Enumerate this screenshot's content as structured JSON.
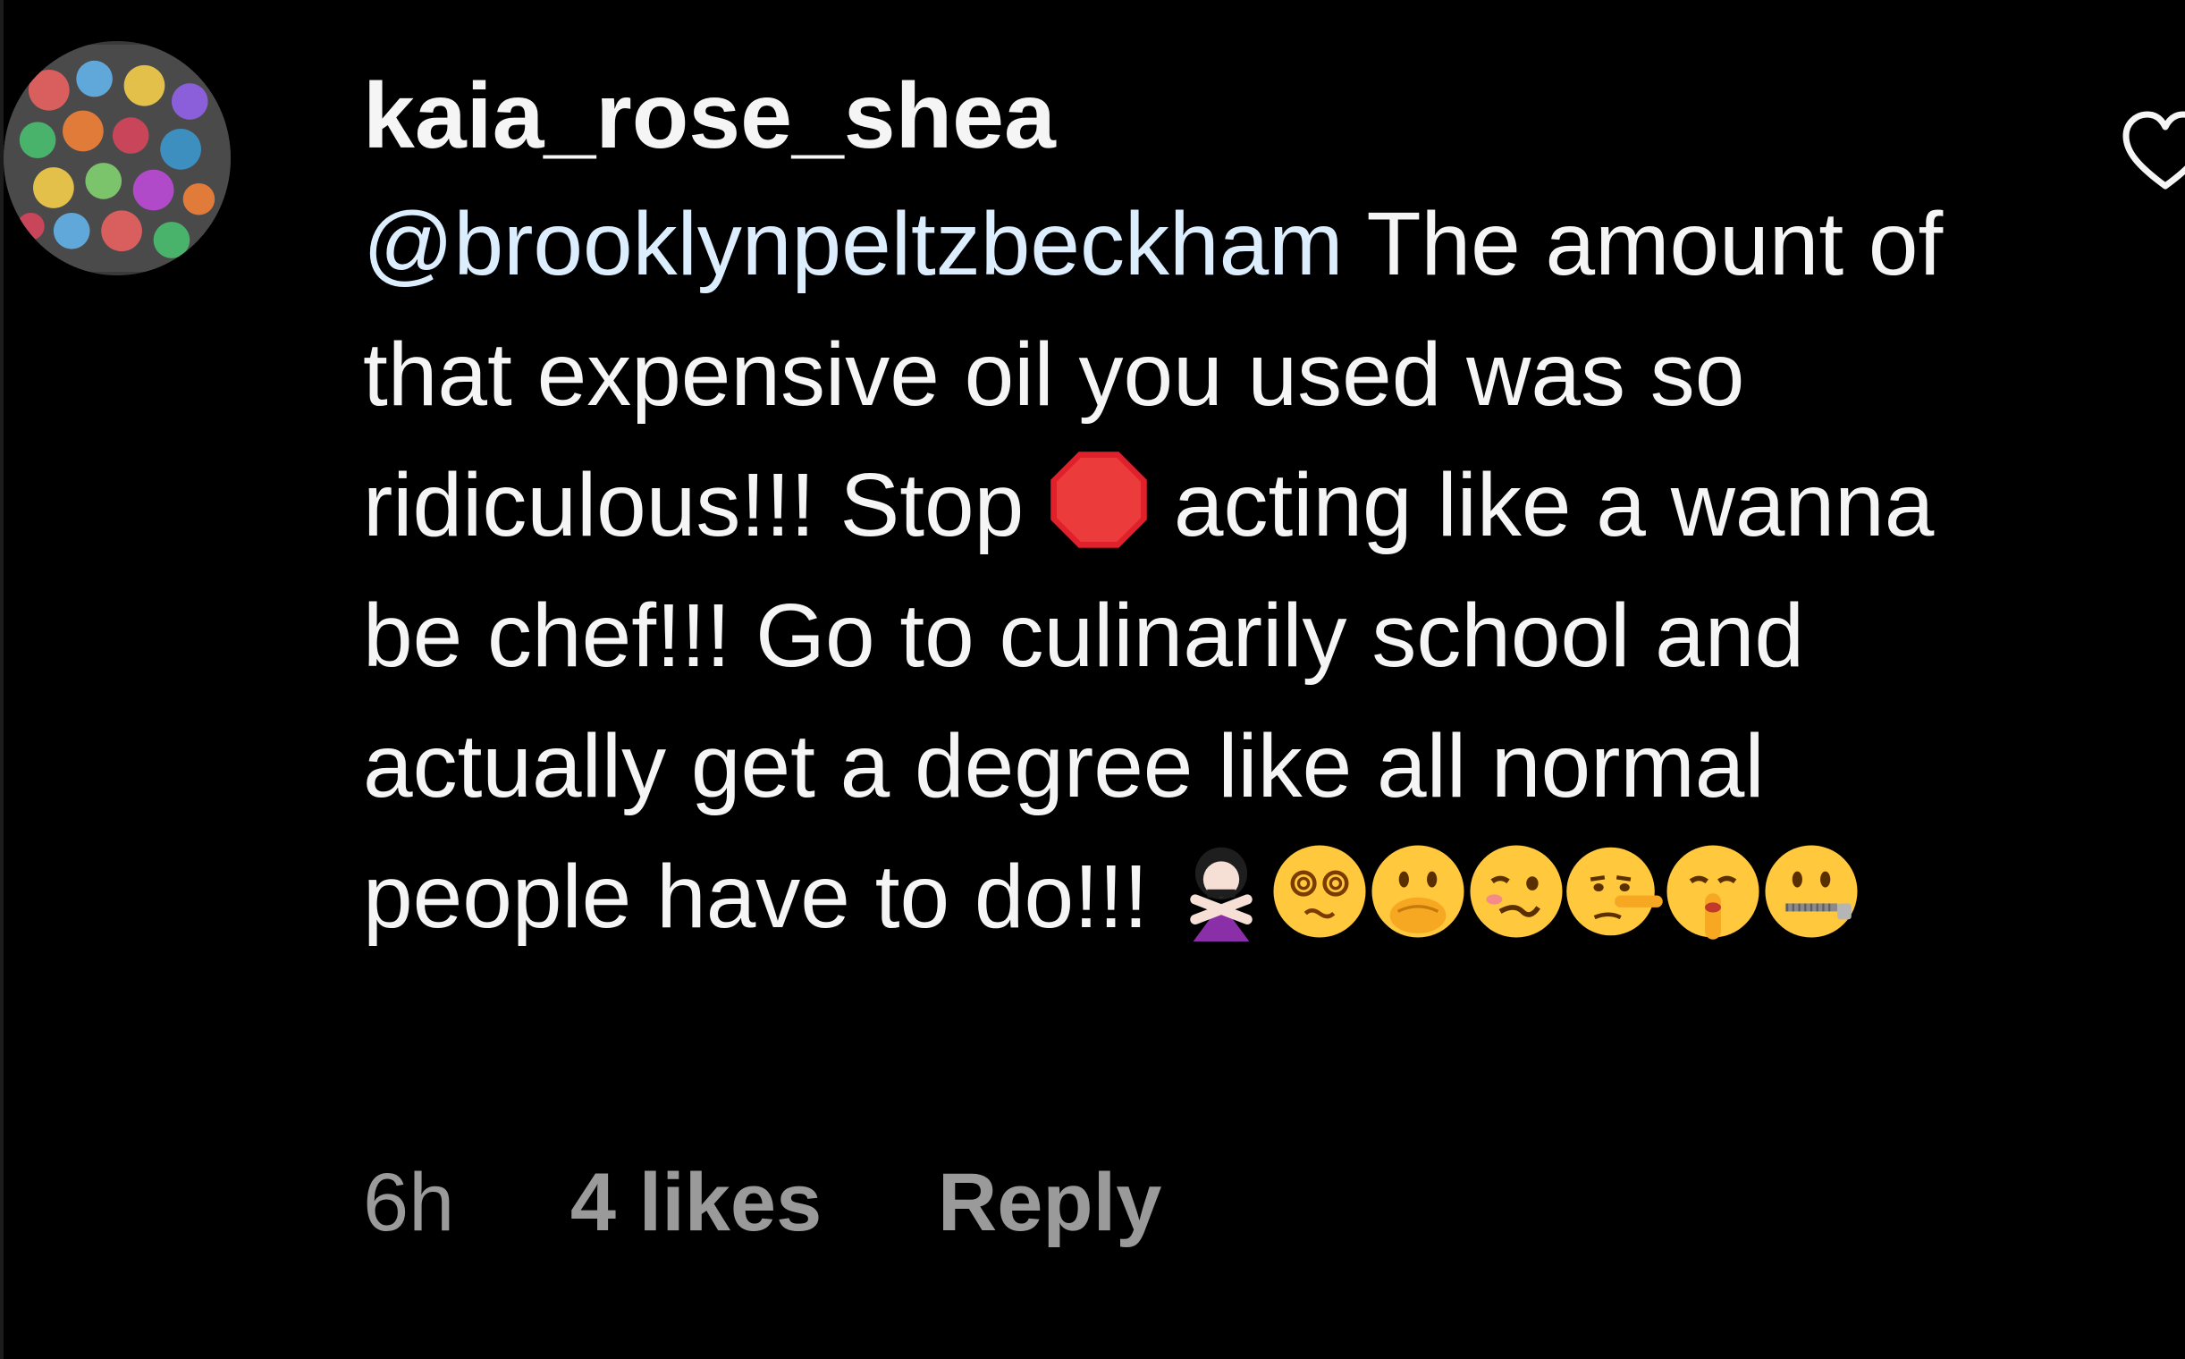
{
  "comment": {
    "username": "kaia_rose_shea",
    "mention": "@brooklynpeltzbeckham",
    "text_before_stop": " The amount of that expensive oil you used was so ridiculous!!! Stop ",
    "text_after_stop": " acting like a wanna be chef!!! Go to culinarily school and actually get a degree like all normal people have to do!!! ",
    "emojis": [
      "stop-sign-emoji",
      "woman-gesturing-no-emoji",
      "dizzy-face-emoji",
      "face-with-hand-over-mouth-emoji",
      "woozy-face-emoji",
      "lying-face-emoji",
      "shushing-face-emoji",
      "zipper-mouth-face-emoji"
    ]
  },
  "meta": {
    "time": "6h",
    "likes": "4 likes",
    "reply": "Reply"
  },
  "icons": {
    "like": "heart-outline-icon",
    "avatar": "avatar-image"
  },
  "colors": {
    "background": "#000000",
    "text": "#f5f5f5",
    "mention": "#dceefe",
    "meta": "#9a9a9a"
  }
}
